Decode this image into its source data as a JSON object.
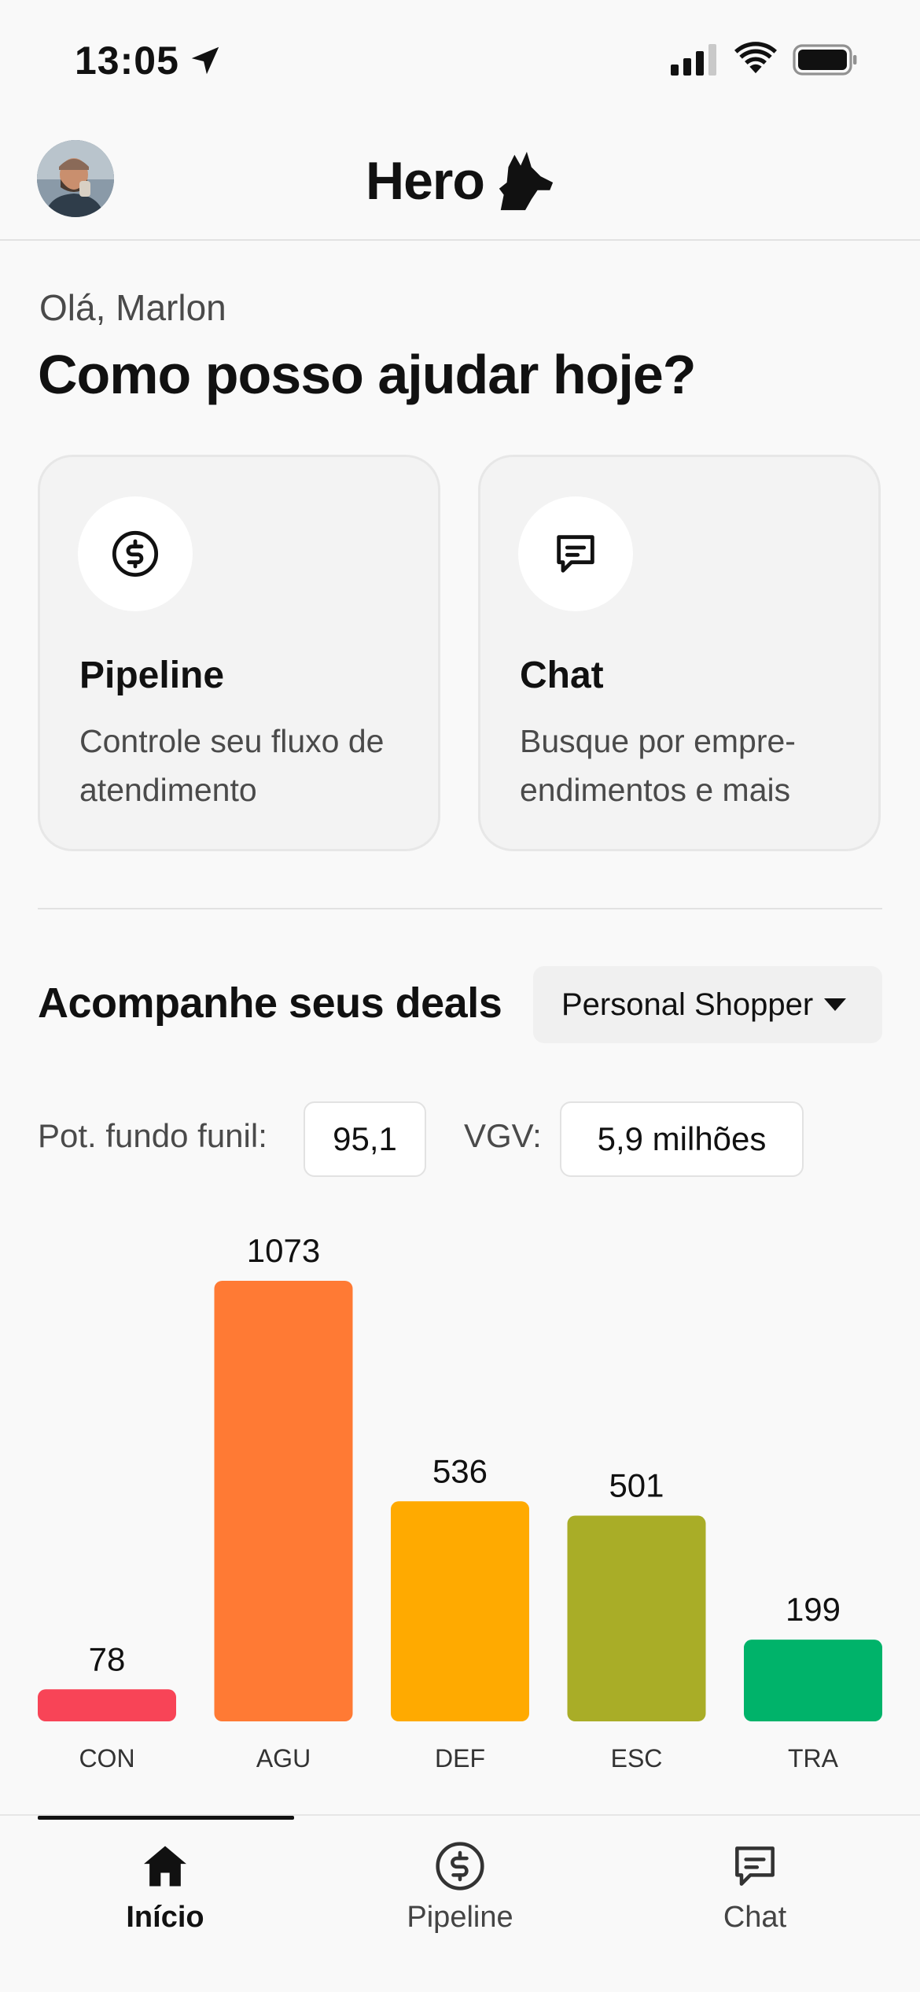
{
  "status_bar": {
    "time": "13:05"
  },
  "header": {
    "brand": "Hero"
  },
  "greeting": "Olá, Marlon",
  "headline": "Como posso ajudar hoje?",
  "cards": [
    {
      "title": "Pipeline",
      "description": "Controle seu fluxo de atendimento",
      "icon": "dollar-circle-icon"
    },
    {
      "title": "Chat",
      "description": "Busque por empre-endimentos e mais",
      "icon": "chat-bubble-icon"
    }
  ],
  "deals": {
    "title": "Acompanhe seus deals",
    "dropdown_value": "Personal Shopper",
    "pot_label": "Pot. fundo funil:",
    "pot_value": "95,1",
    "vgv_label": "VGV:",
    "vgv_value": "5,9 milhões"
  },
  "chart_data": {
    "type": "bar",
    "categories": [
      "CON",
      "AGU",
      "DEF",
      "ESC",
      "TRA"
    ],
    "values": [
      78,
      1073,
      536,
      501,
      199
    ],
    "colors": [
      "#f84457",
      "#ff7a34",
      "#ffaa00",
      "#a9ad27",
      "#00b36a"
    ],
    "title": "",
    "xlabel": "",
    "ylabel": "",
    "ylim": [
      0,
      1073
    ],
    "grid": false
  },
  "bottom_nav": [
    {
      "label": "Início",
      "icon": "home-icon",
      "active": true
    },
    {
      "label": "Pipeline",
      "icon": "dollar-circle-icon",
      "active": false
    },
    {
      "label": "Chat",
      "icon": "chat-bubble-icon",
      "active": false
    }
  ]
}
